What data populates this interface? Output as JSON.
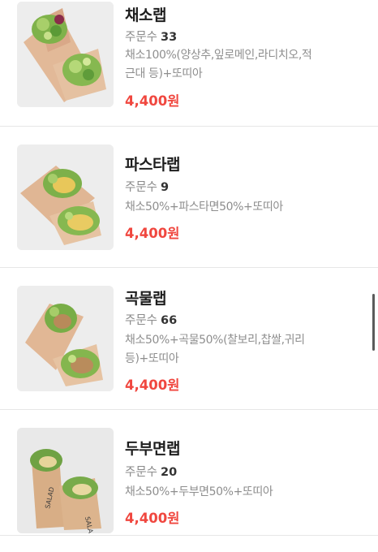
{
  "menu_items": [
    {
      "name": "채소랩",
      "orders_label": "주문수",
      "orders_count": "33",
      "description": "채소100%(양상추,잎로메인,라디치오,적근대 등)+또띠아",
      "price": "4,400원"
    },
    {
      "name": "파스타랩",
      "orders_label": "주문수",
      "orders_count": "9",
      "description": "채소50%+파스타면50%+또띠아",
      "price": "4,400원"
    },
    {
      "name": "곡물랩",
      "orders_label": "주문수",
      "orders_count": "66",
      "description": "채소50%+곡물50%(찰보리,찹쌀,귀리 등)+또띠아",
      "price": "4,400원"
    },
    {
      "name": "두부면랩",
      "orders_label": "주문수",
      "orders_count": "20",
      "description": "채소50%+두부면50%+또띠아",
      "price": "4,400원"
    }
  ],
  "wrapper_print": "SALAD",
  "colors": {
    "price": "#f0473f",
    "title": "#1e1e1e",
    "muted": "#8a8a8a",
    "divider": "#e6e6e6"
  }
}
